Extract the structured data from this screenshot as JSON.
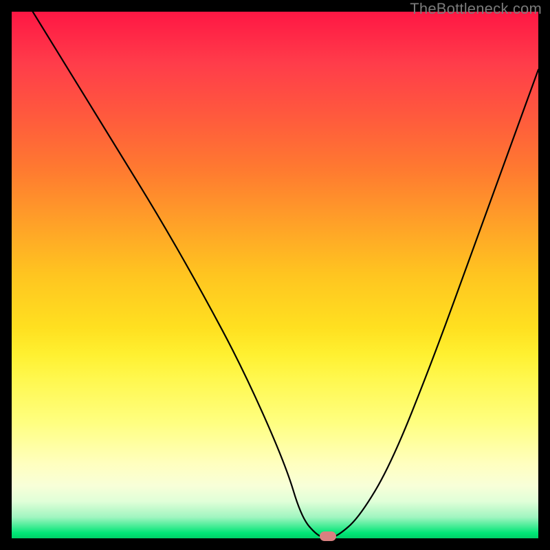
{
  "watermark": "TheBottleneck.com",
  "chart_data": {
    "type": "line",
    "title": "",
    "xlabel": "",
    "ylabel": "",
    "xlim": [
      0,
      100
    ],
    "ylim": [
      0,
      100
    ],
    "grid": false,
    "series": [
      {
        "name": "bottleneck-curve",
        "x": [
          4,
          12,
          20,
          28,
          36,
          44,
          52,
          55,
          58,
          60,
          62,
          66,
          72,
          80,
          88,
          96,
          100
        ],
        "y": [
          100,
          87,
          74,
          61,
          47,
          32,
          14,
          4,
          0.5,
          0,
          0.5,
          4,
          14,
          34,
          56,
          78,
          89
        ]
      }
    ],
    "marker": {
      "x": 60,
      "y": 0,
      "color": "#d88080"
    },
    "gradient_stops": [
      {
        "pct": 0,
        "color": "#ff1744"
      },
      {
        "pct": 50,
        "color": "#ffe020"
      },
      {
        "pct": 85,
        "color": "#ffffc0"
      },
      {
        "pct": 100,
        "color": "#00d068"
      }
    ]
  }
}
